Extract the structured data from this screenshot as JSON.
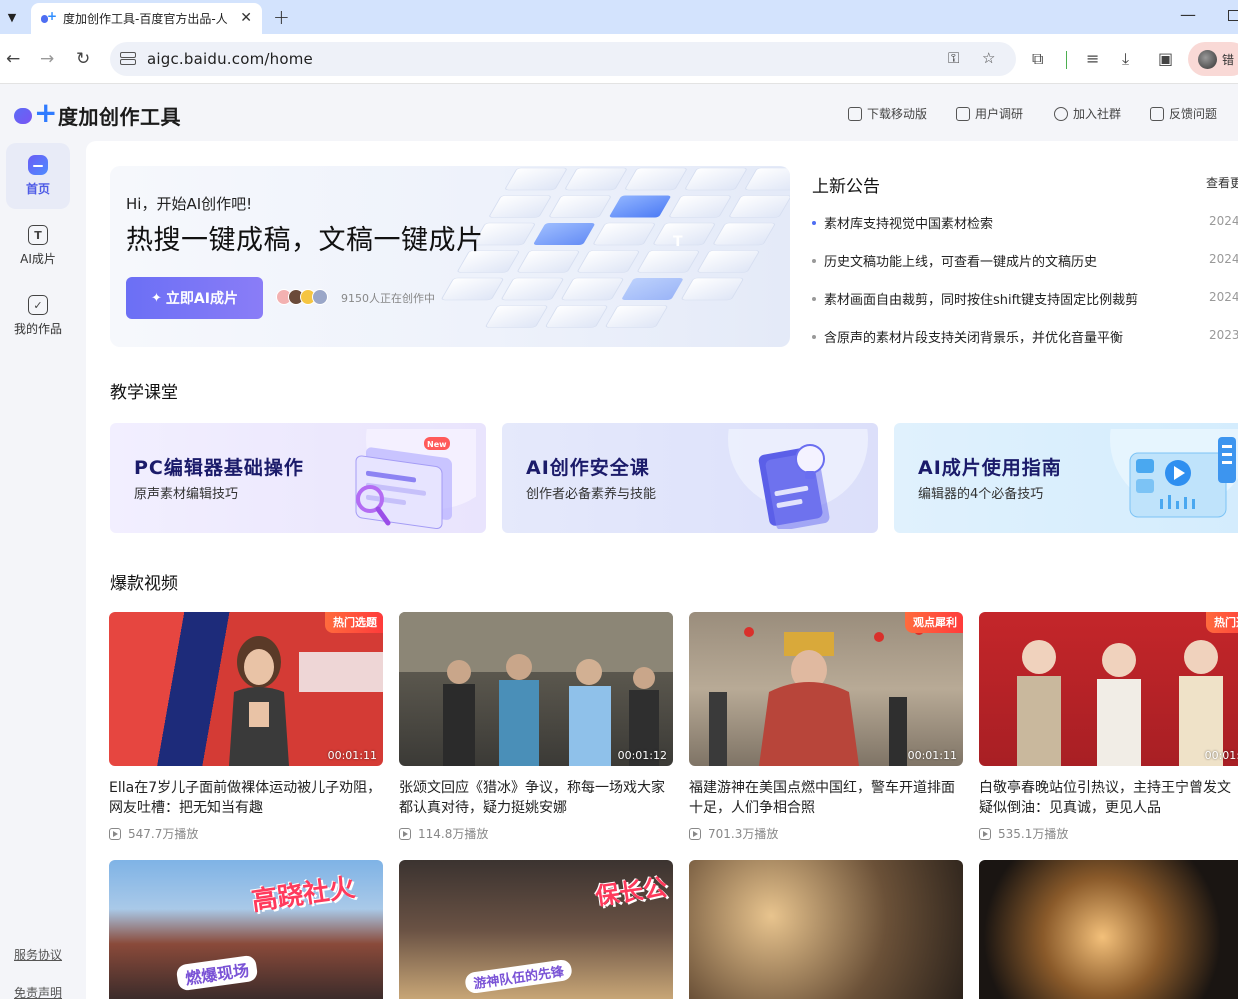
{
  "browser": {
    "tab_title": "度加创作工具-百度官方出品-人",
    "url": "aigc.baidu.com/home",
    "profile_text": "错"
  },
  "header": {
    "logo_text": "度加创作工具",
    "links": [
      {
        "label": "下载移动版",
        "icon": "phone-icon"
      },
      {
        "label": "用户调研",
        "icon": "survey-icon"
      },
      {
        "label": "加入社群",
        "icon": "chat-icon"
      },
      {
        "label": "反馈问题",
        "icon": "edit-icon"
      }
    ]
  },
  "sidebar": {
    "items": [
      {
        "label": "首页",
        "icon": "home-icon",
        "active": true
      },
      {
        "label": "AI成片",
        "icon": "text-icon",
        "active": false
      },
      {
        "label": "我的作品",
        "icon": "check-icon",
        "active": false
      }
    ],
    "footer": [
      "服务协议",
      "免责声明"
    ]
  },
  "hero": {
    "greeting": "Hi，开始AI创作吧!",
    "title": "热搜一键成稿，文稿一键成片",
    "button": "立即AI成片",
    "creating_text": "9150人正在创作中"
  },
  "notice": {
    "title": "上新公告",
    "more": "查看更",
    "items": [
      {
        "text": "素材库支持视觉中国素材检索",
        "date": "2024",
        "new": true
      },
      {
        "text": "历史文稿功能上线，可查看一键成片的文稿历史",
        "date": "2024",
        "new": false
      },
      {
        "text": "素材画面自由裁剪，同时按住shift键支持固定比例裁剪",
        "date": "2024",
        "new": false
      },
      {
        "text": "含原声的素材片段支持关闭背景乐，并优化音量平衡",
        "date": "2023-",
        "new": false
      }
    ]
  },
  "courses": {
    "title": "教学课堂",
    "items": [
      {
        "title": "PC编辑器基础操作",
        "subtitle": "原声素材编辑技巧",
        "tag": "New"
      },
      {
        "title": "AI创作安全课",
        "subtitle": "创作者必备素养与技能"
      },
      {
        "title": "AI成片使用指南",
        "subtitle": "编辑器的4个必备技巧"
      }
    ]
  },
  "videos": {
    "title": "爆款视频",
    "items": [
      {
        "title": "Ella在7岁儿子面前做裸体运动被儿子劝阻，网友吐槽：把无知当有趣",
        "plays": "547.7万播放",
        "duration": "00:01:11",
        "badge": "热门选题"
      },
      {
        "title": "张颂文回应《猎冰》争议，称每一场戏大家都认真对待，疑力挺姚安娜",
        "plays": "114.8万播放",
        "duration": "00:01:12",
        "badge": ""
      },
      {
        "title": "福建游神在美国点燃中国红，警车开道排面十足，人们争相合照",
        "plays": "701.3万播放",
        "duration": "00:01:11",
        "badge": "观点犀利"
      },
      {
        "title": "白敬亭春晚站位引热议，主持王宁曾发文疑似倒油：见真诚，更见人品",
        "plays": "535.1万播放",
        "duration": "00:01:0",
        "badge": "热门选"
      }
    ],
    "row2_captions": [
      "高跷社火",
      "燃爆现场",
      "保长公",
      "游神队伍的先锋"
    ]
  }
}
